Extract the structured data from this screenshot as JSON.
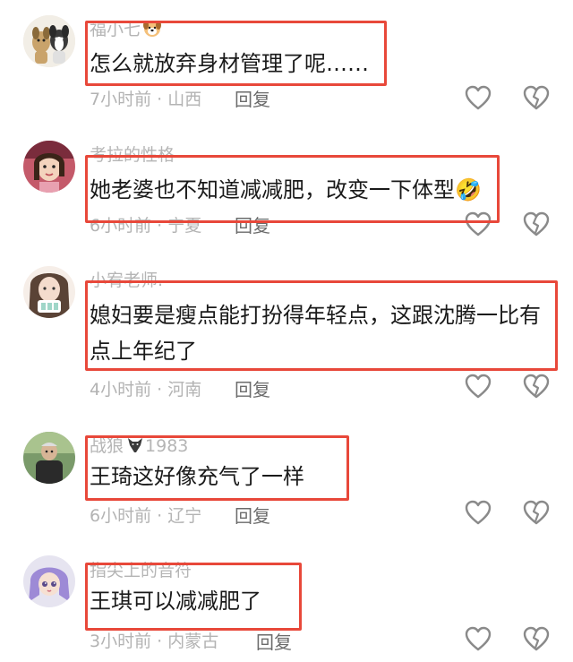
{
  "comments": [
    {
      "username": "福小七",
      "username_emoji": "dog-face-icon",
      "text_lines": [
        "怎么就放弃身材管理了呢……"
      ],
      "time": "7小时前",
      "location": "山西",
      "reply_label": "回复"
    },
    {
      "username": "考拉的性格",
      "text_lines": [
        "她老婆也不知道减减肥，改变一下体型🤣"
      ],
      "time": "6小时前",
      "location": "宁夏",
      "reply_label": "回复"
    },
    {
      "username": "小宥老师.",
      "text_lines": [
        "媳妇要是瘦点能打扮得年轻点，这跟沈腾一比有",
        "点上年纪了"
      ],
      "time": "4小时前",
      "location": "河南",
      "reply_label": "回复"
    },
    {
      "username": "战狼",
      "username_suffix": "1983",
      "username_emoji": "wolf-head-icon",
      "text_lines": [
        "王琦这好像充气了一样"
      ],
      "time": "6小时前",
      "location": "辽宁",
      "reply_label": "回复"
    },
    {
      "username": "指尖上的音符",
      "text_lines": [
        "王琪可以减减肥了"
      ],
      "time": "3小时前",
      "location": "内蒙古",
      "reply_label": "回复"
    }
  ],
  "separator": "·",
  "icons": {
    "like": "heart-outline-icon",
    "dislike": "broken-heart-outline-icon"
  },
  "colors": {
    "highlight_border": "#e8483a",
    "username": "#b5b5b5",
    "meta": "#b3b3b3",
    "text": "#1a1a1a",
    "reply": "#6b6b6b"
  }
}
